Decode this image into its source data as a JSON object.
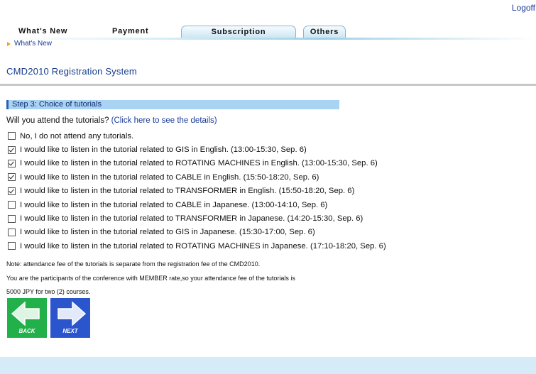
{
  "header": {
    "logoff_label": "Logoff"
  },
  "tabs": [
    {
      "label": "What's New"
    },
    {
      "label": "Payment"
    },
    {
      "label": "Subscription"
    },
    {
      "label": "Others"
    }
  ],
  "breadcrumb": {
    "label": "What's New"
  },
  "page": {
    "title": "CMD2010 Registration System"
  },
  "step": {
    "header": "Step 3: Choice of tutorials"
  },
  "question": {
    "text": "Will you attend the tutorials? ",
    "link": "(Click here to see the details)"
  },
  "options": [
    {
      "label": "No, I do not attend any tutorials.",
      "checked": false
    },
    {
      "label": "I would like to listen in the tutorial related to GIS in English. (13:00-15:30, Sep. 6)",
      "checked": true
    },
    {
      "label": "I would like to listen in the tutorial related to ROTATING MACHINES in English. (13:00-15:30, Sep. 6)",
      "checked": true
    },
    {
      "label": "I would like to listen in the tutorial related to CABLE in English. (15:50-18:20, Sep. 6)",
      "checked": true
    },
    {
      "label": "I would like to listen in the tutorial related to TRANSFORMER in English. (15:50-18:20, Sep. 6)",
      "checked": true
    },
    {
      "label": "I would like to listen in the tutorial related to CABLE in Japanese. (13:00-14:10, Sep. 6)",
      "checked": false
    },
    {
      "label": "I would like to listen in the tutorial related to TRANSFORMER in Japanese. (14:20-15:30, Sep. 6)",
      "checked": false
    },
    {
      "label": "I would like to listen in the tutorial related to GIS in Japanese. (15:30-17:00, Sep. 6)",
      "checked": false
    },
    {
      "label": "I would like to listen in the tutorial related to ROTATING MACHINES in Japanese. (17:10-18:20, Sep. 6)",
      "checked": false
    }
  ],
  "notes": [
    "Note: attendance fee of the tutorials is separate from the registration fee of the CMD2010.",
    "You are the participants of the conference with MEMBER rate,so your attendance fee of the tutorials is",
    "5000 JPY for two (2) courses."
  ],
  "buttons": {
    "back_label": "BACK",
    "next_label": "NEXT"
  },
  "colors": {
    "back_button": "#22b04a",
    "next_button": "#2a55cc",
    "step_header": "#a9d3f3",
    "link": "#1a3a99"
  }
}
